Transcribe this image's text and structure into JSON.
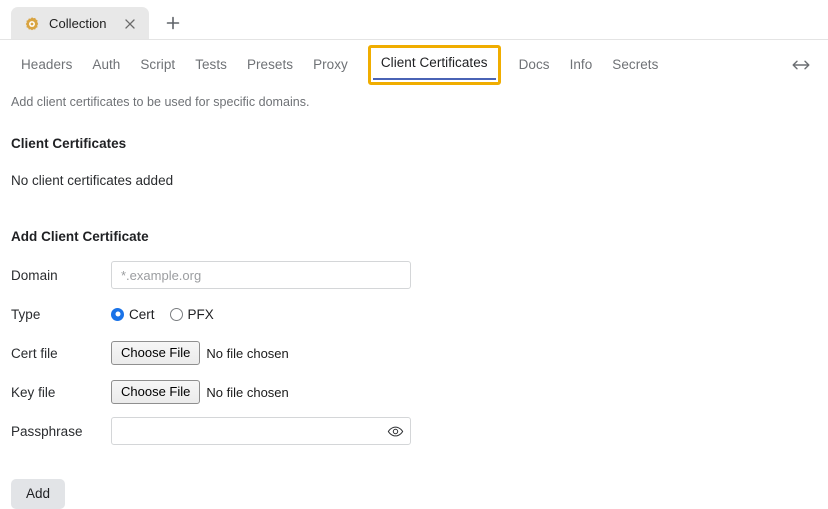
{
  "browser": {
    "tab": {
      "favicon_name": "collection-gear-icon",
      "favicon_color": "#d9a441",
      "title": "Collection",
      "close_icon": "close-icon"
    },
    "new_tab_icon": "plus-icon"
  },
  "navbar": {
    "tabs": [
      {
        "label": "Headers",
        "active": false
      },
      {
        "label": "Auth",
        "active": false
      },
      {
        "label": "Script",
        "active": false
      },
      {
        "label": "Tests",
        "active": false
      },
      {
        "label": "Presets",
        "active": false
      },
      {
        "label": "Proxy",
        "active": false
      },
      {
        "label": "Client Certificates",
        "active": true
      },
      {
        "label": "Docs",
        "active": false
      },
      {
        "label": "Info",
        "active": false
      },
      {
        "label": "Secrets",
        "active": false
      }
    ],
    "focus_ring_color": "#f0ad00",
    "active_underline_color": "#4a63b5",
    "resize_icon": "resize-horizontal-icon"
  },
  "main": {
    "intro_text": "Add client certificates to be used for specific domains.",
    "list_heading": "Client Certificates",
    "empty_message": "No client certificates added",
    "form_heading": "Add Client Certificate",
    "form": {
      "domain": {
        "label": "Domain",
        "value": "",
        "placeholder": "*.example.org"
      },
      "type": {
        "label": "Type",
        "selected": "Cert",
        "accent_color": "#1a73e8",
        "options": [
          {
            "label": "Cert",
            "checked": true
          },
          {
            "label": "PFX",
            "checked": false
          }
        ]
      },
      "cert_file": {
        "label": "Cert file",
        "button_label": "Choose File",
        "status": "No file chosen"
      },
      "key_file": {
        "label": "Key file",
        "button_label": "Choose File",
        "status": "No file chosen"
      },
      "passphrase": {
        "label": "Passphrase",
        "value": "",
        "placeholder": "",
        "reveal_icon": "eye-icon"
      },
      "submit_label": "Add"
    }
  }
}
